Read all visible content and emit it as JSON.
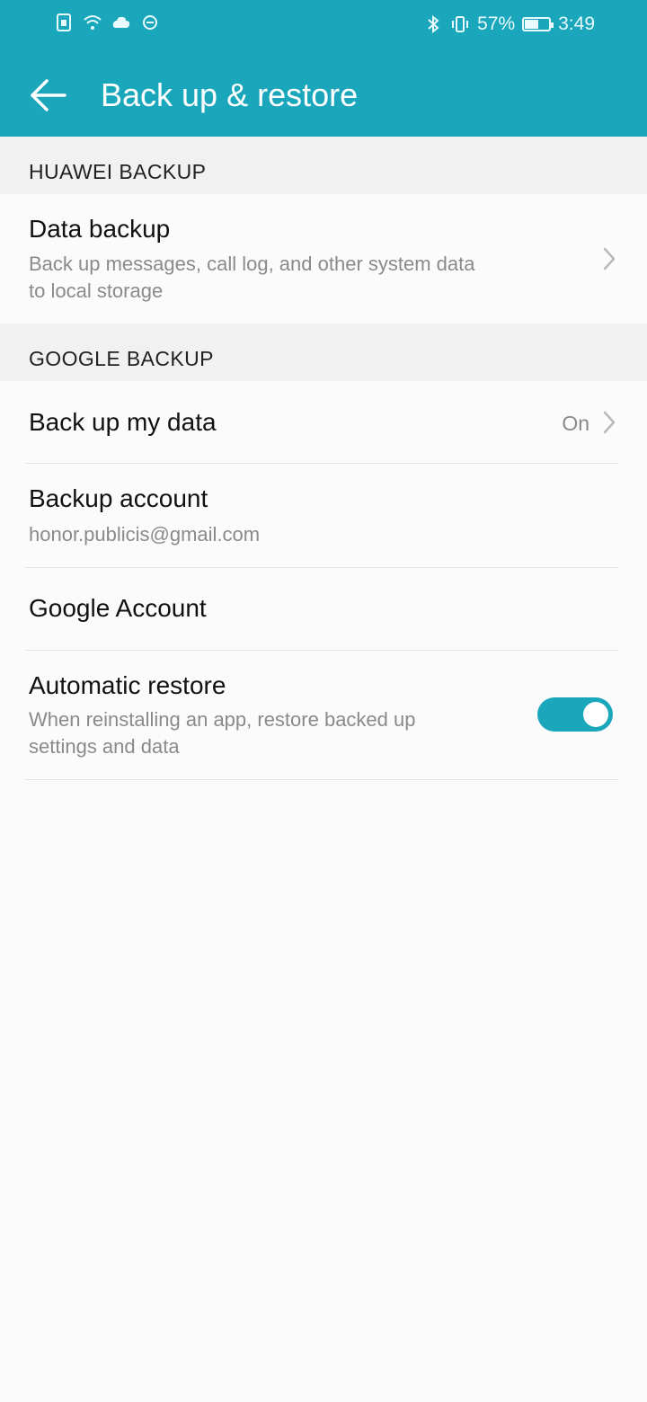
{
  "status_bar": {
    "battery_percent": "57%",
    "battery_level": 0.57,
    "time": "3:49",
    "icons_left": [
      "sim-icon",
      "wifi-icon",
      "cloud-icon",
      "data-saver-icon"
    ],
    "icons_right": [
      "bluetooth-icon",
      "vibrate-icon",
      "battery-icon"
    ]
  },
  "header": {
    "title": "Back up & restore",
    "back_icon": "back-arrow-icon"
  },
  "sections": [
    {
      "header": "HUAWEI BACKUP",
      "items": [
        {
          "title": "Data backup",
          "subtitle_line1": "Back up messages, call log, and other system data",
          "subtitle_line2": "to local storage"
        }
      ]
    },
    {
      "header": "GOOGLE BACKUP",
      "items": [
        {
          "title": "Back up my data",
          "value": "On"
        },
        {
          "title": "Backup account",
          "subtitle": "honor.publicis@gmail.com"
        },
        {
          "title": "Google Account"
        },
        {
          "title": "Automatic restore",
          "subtitle_line1": "When reinstalling an app, restore backed up",
          "subtitle_line2": "settings and data",
          "toggle_on": true
        }
      ]
    }
  ],
  "colors": {
    "accent": "#1aa7bb",
    "background": "#fafafa",
    "section_header_bg": "#f1f1f1"
  }
}
